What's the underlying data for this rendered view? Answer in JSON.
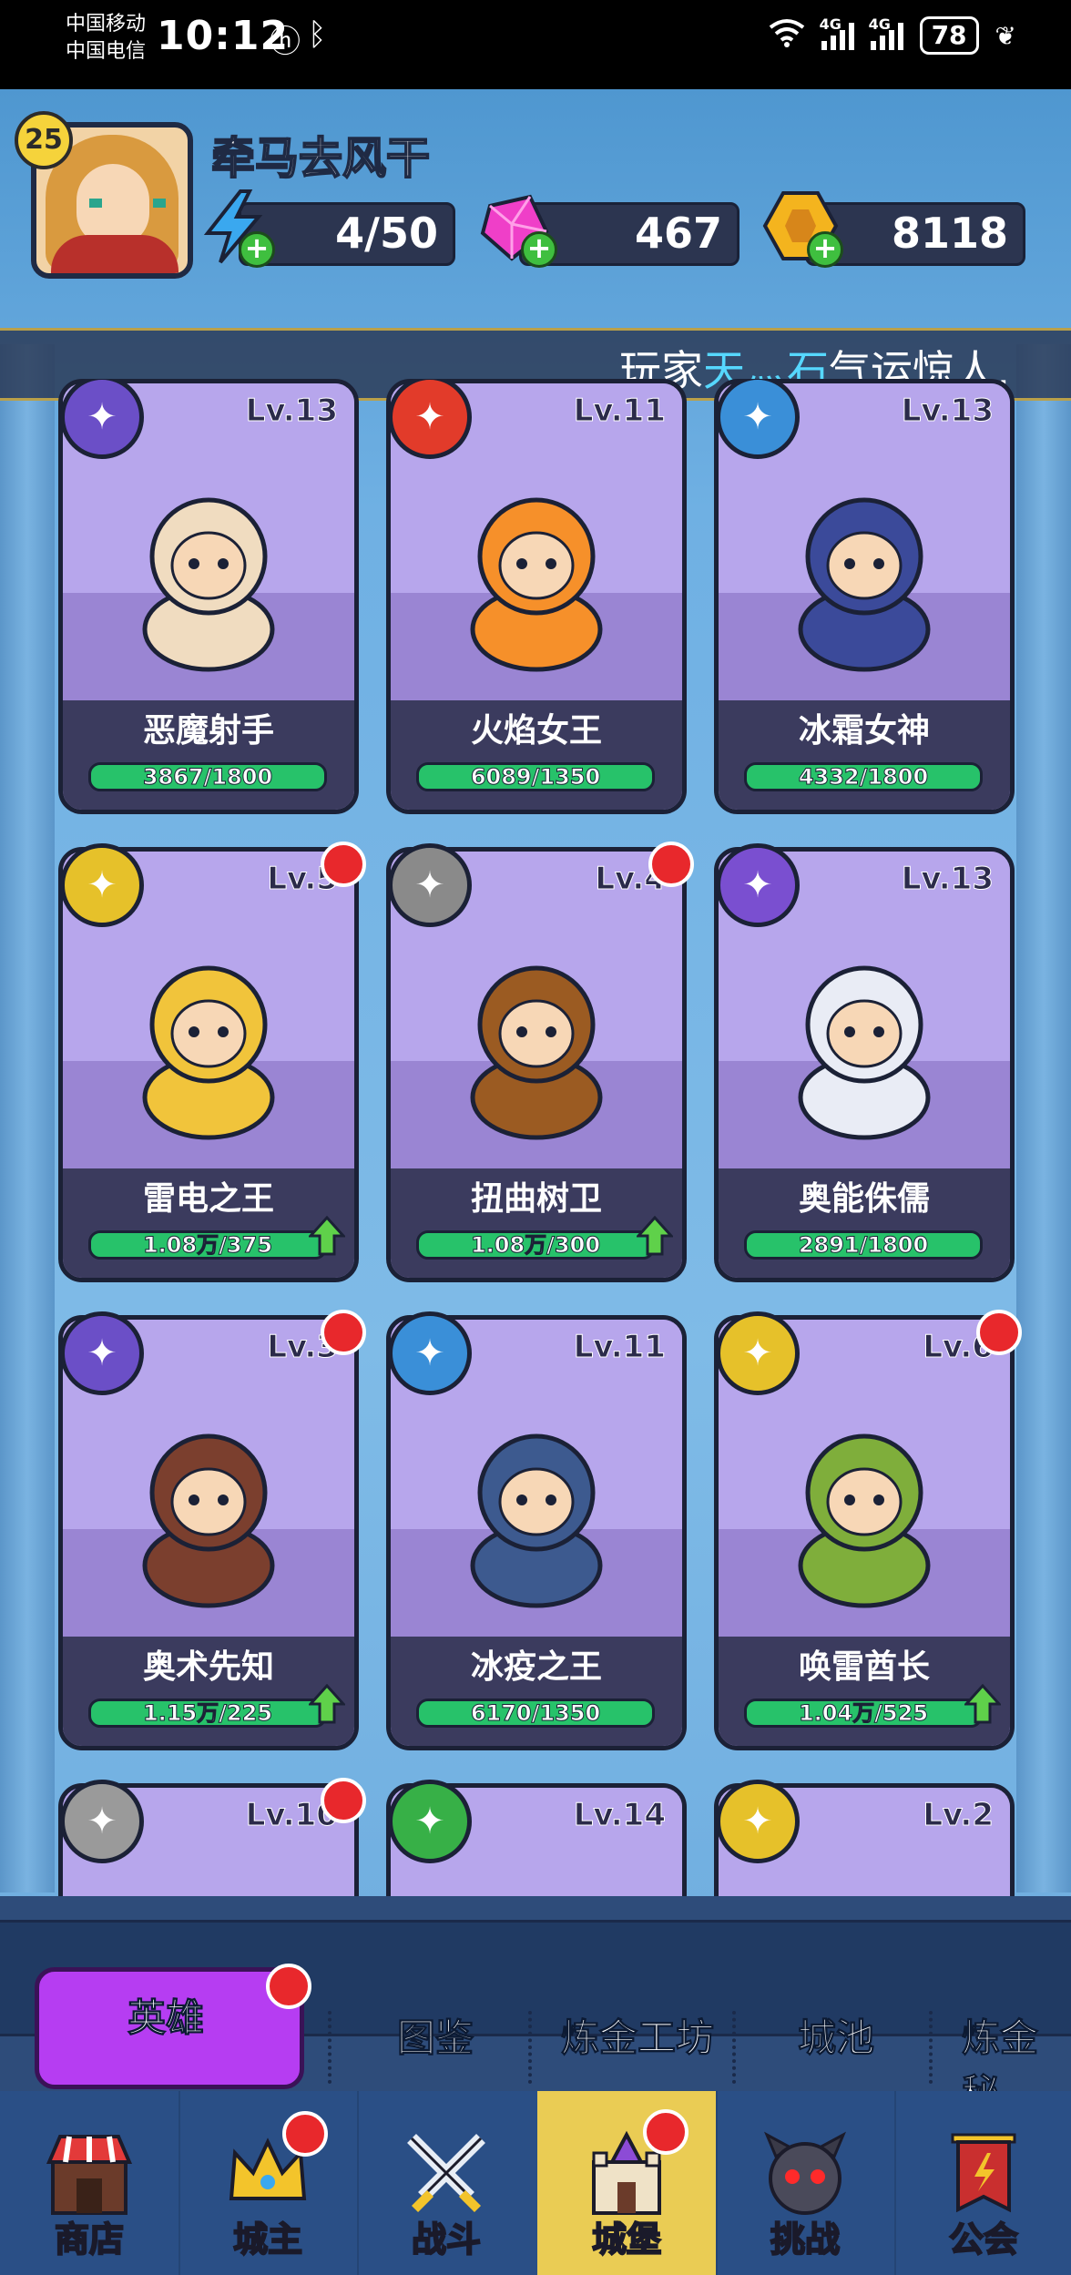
{
  "status_bar": {
    "carrier_1": "中国移动",
    "carrier_2": "中国电信",
    "time": "10:12",
    "signal_1_label": "4G",
    "signal_2_label": "4G",
    "battery": "78"
  },
  "player": {
    "level": "25",
    "name": "牵马去风干",
    "energy": "4/50",
    "gems": "467",
    "gold": "8118"
  },
  "ticker": {
    "prefix": "玩家",
    "highlight": "天灬石",
    "suffix": "气运惊人,"
  },
  "heroes": [
    {
      "name": "恶魔射手",
      "level": "Lv.13",
      "progress": "3867/1800",
      "type_icon": "arrow-type-icon",
      "red_dot": false,
      "upgrade": false,
      "colors": {
        "type_bg": "#6b4fc7",
        "main": "#f0dcc0"
      }
    },
    {
      "name": "火焰女王",
      "level": "Lv.11",
      "progress": "6089/1350",
      "type_icon": "fire-target-type-icon",
      "red_dot": false,
      "upgrade": false,
      "colors": {
        "type_bg": "#e23b2a",
        "main": "#f6902a"
      }
    },
    {
      "name": "冰霜女神",
      "level": "Lv.13",
      "progress": "4332/1800",
      "type_icon": "crystal-type-icon",
      "red_dot": false,
      "upgrade": false,
      "colors": {
        "type_bg": "#3a8fd8",
        "main": "#3b4a9a"
      }
    },
    {
      "name": "雷电之王",
      "level": "Lv.5",
      "progress": "1.08万/375",
      "type_icon": "lightning-type-icon",
      "red_dot": true,
      "upgrade": true,
      "colors": {
        "type_bg": "#e6c12a",
        "main": "#f1c43b"
      }
    },
    {
      "name": "扭曲树卫",
      "level": "Lv.4",
      "progress": "1.08万/300",
      "type_icon": "shield-type-icon",
      "red_dot": true,
      "upgrade": true,
      "colors": {
        "type_bg": "#8a8a8a",
        "main": "#9b5b22"
      }
    },
    {
      "name": "奥能侏儒",
      "level": "Lv.13",
      "progress": "2891/1800",
      "type_icon": "claw-type-icon",
      "red_dot": false,
      "upgrade": false,
      "colors": {
        "type_bg": "#7a4fd0",
        "main": "#e9ecf5"
      }
    },
    {
      "name": "奥术先知",
      "level": "Lv.3",
      "progress": "1.15万/225",
      "type_icon": "cross-arrows-type-icon",
      "red_dot": true,
      "upgrade": true,
      "colors": {
        "type_bg": "#6b4fc7",
        "main": "#7b3f2e"
      }
    },
    {
      "name": "冰疫之王",
      "level": "Lv.11",
      "progress": "6170/1350",
      "type_icon": "ice-crystal-type-icon",
      "red_dot": false,
      "upgrade": false,
      "colors": {
        "type_bg": "#3a8fd8",
        "main": "#3d5a8f"
      }
    },
    {
      "name": "唤雷酋长",
      "level": "Lv.6",
      "progress": "1.04万/525",
      "type_icon": "storm-type-icon",
      "red_dot": true,
      "upgrade": true,
      "colors": {
        "type_bg": "#e6c12a",
        "main": "#7fae3b"
      }
    },
    {
      "name": "",
      "level": "Lv.10",
      "progress": "",
      "type_icon": "gray-type-icon",
      "red_dot": true,
      "upgrade": false,
      "colors": {
        "type_bg": "#9a9a9a",
        "main": "#a994e0"
      }
    },
    {
      "name": "",
      "level": "Lv.14",
      "progress": "",
      "type_icon": "green-type-icon",
      "red_dot": false,
      "upgrade": false,
      "colors": {
        "type_bg": "#37b047",
        "main": "#a994e0"
      }
    },
    {
      "name": "",
      "level": "Lv.2",
      "progress": "",
      "type_icon": "yellow-type-icon",
      "red_dot": false,
      "upgrade": false,
      "colors": {
        "type_bg": "#e6c12a",
        "main": "#a994e0"
      }
    }
  ],
  "sub_tabs": {
    "heroes": "英雄",
    "codex": "图鉴",
    "alchemy_workshop": "炼金工坊",
    "city": "城池",
    "alchemy_secret": "炼金秘"
  },
  "bottom_nav": {
    "shop": "商店",
    "lord": "城主",
    "battle": "战斗",
    "castle": "城堡",
    "challenge": "挑战",
    "guild": "公会"
  },
  "colors": {
    "accent_purple": "#b63df2",
    "active_nav": "#eacc54",
    "red_dot": "#e8282c",
    "progress_green": "#27c26a"
  }
}
